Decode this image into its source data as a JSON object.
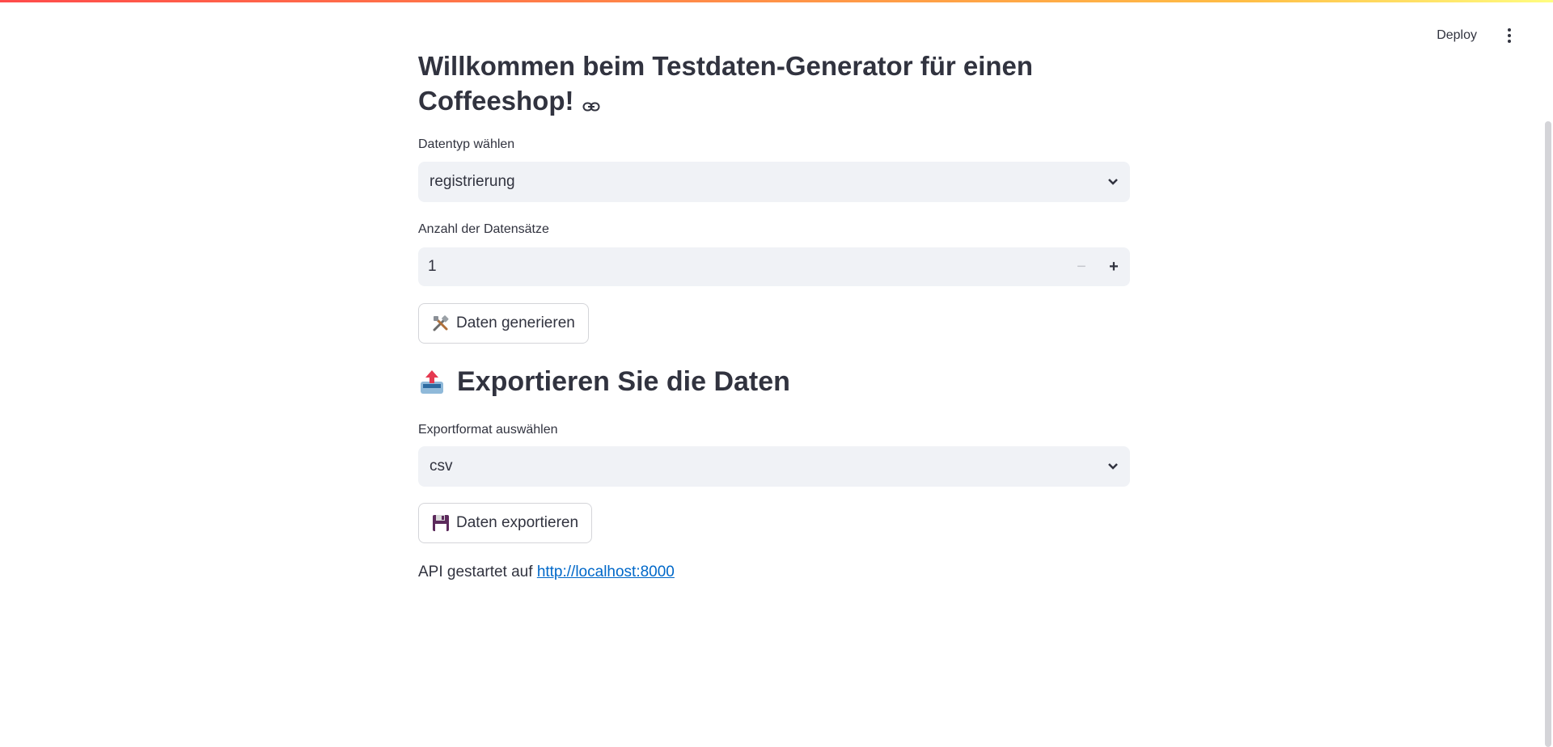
{
  "header": {
    "deploy_label": "Deploy",
    "menu_icon": "more-vertical-icon"
  },
  "main": {
    "title": "Willkommen beim Testdaten-Generator für einen Coffeeshop!",
    "datatype": {
      "label": "Datentyp wählen",
      "value": "registrierung"
    },
    "count": {
      "label": "Anzahl der Datensätze",
      "value": "1",
      "minus": "−",
      "plus": "+"
    },
    "generate_button": {
      "icon": "tools-icon",
      "label": "Daten generieren"
    },
    "export_heading": {
      "icon": "outbox-tray-icon",
      "text": "Exportieren Sie die Daten"
    },
    "export_format": {
      "label": "Exportformat auswählen",
      "value": "csv"
    },
    "export_button": {
      "icon": "floppy-disk-icon",
      "label": "Daten exportieren"
    },
    "api": {
      "prefix": "API gestartet auf",
      "link": "http://localhost:8000"
    }
  },
  "colors": {
    "accent": "#ff4b4b",
    "input_bg": "#f0f2f6",
    "link": "#0068c9",
    "text": "#31333f"
  }
}
